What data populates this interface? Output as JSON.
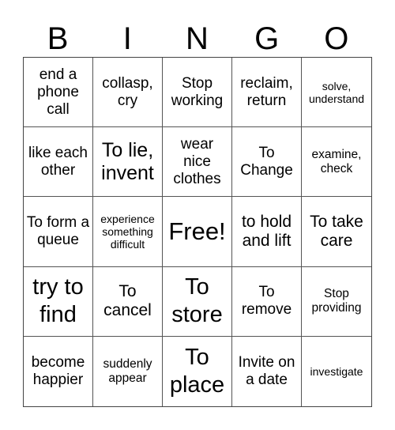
{
  "header": {
    "letters": [
      "B",
      "I",
      "N",
      "G",
      "O"
    ]
  },
  "grid": {
    "rows": [
      [
        {
          "text": "end a phone call",
          "size": "m"
        },
        {
          "text": "collasp, cry",
          "size": "m"
        },
        {
          "text": "Stop working",
          "size": "m"
        },
        {
          "text": "reclaim, return",
          "size": "m"
        },
        {
          "text": "solve, understand",
          "size": "xs"
        }
      ],
      [
        {
          "text": "like each other",
          "size": "m"
        },
        {
          "text": "To lie, invent",
          "size": "l"
        },
        {
          "text": "wear nice clothes",
          "size": "m"
        },
        {
          "text": "To Change",
          "size": "m"
        },
        {
          "text": "examine, check",
          "size": "s"
        }
      ],
      [
        {
          "text": "To form a queue",
          "size": "m"
        },
        {
          "text": "experience something difficult",
          "size": "xs"
        },
        {
          "text": "Free!",
          "size": "free"
        },
        {
          "text": "to hold and lift",
          "size": "ml"
        },
        {
          "text": "To take care",
          "size": "ml"
        }
      ],
      [
        {
          "text": "try to find",
          "size": "xl"
        },
        {
          "text": "To cancel",
          "size": "ml"
        },
        {
          "text": "To store",
          "size": "xl"
        },
        {
          "text": "To remove",
          "size": "m"
        },
        {
          "text": "Stop providing",
          "size": "s"
        }
      ],
      [
        {
          "text": "become happier",
          "size": "m"
        },
        {
          "text": "suddenly appear",
          "size": "s"
        },
        {
          "text": "To place",
          "size": "xl"
        },
        {
          "text": "Invite on a date",
          "size": "m"
        },
        {
          "text": "investigate",
          "size": "xs"
        }
      ]
    ]
  },
  "colors": {
    "background": "#ffffff",
    "text": "#000000",
    "grid_line": "#555555"
  }
}
